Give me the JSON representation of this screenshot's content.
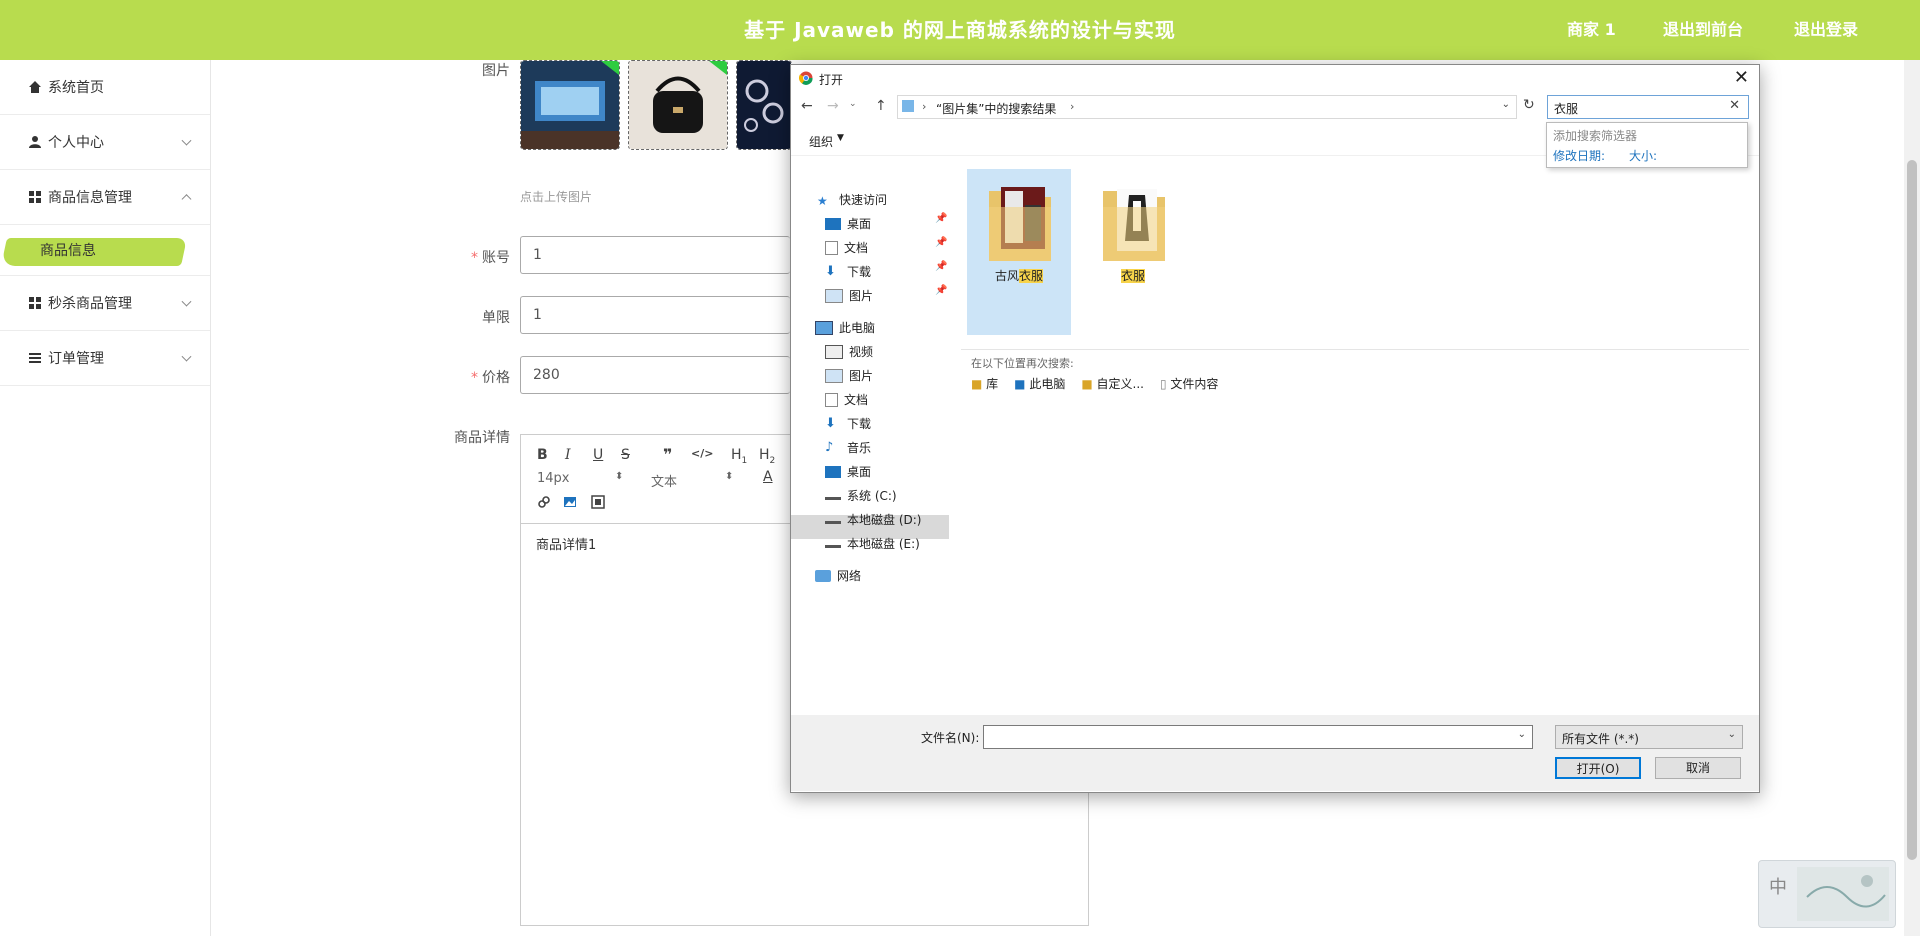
{
  "header": {
    "title": "基于 Javaweb 的网上商城系统的设计与实现",
    "links": [
      "商家 1",
      "退出到前台",
      "退出登录"
    ]
  },
  "sidebar": {
    "items": [
      {
        "label": "系统首页",
        "icon": "home-icon"
      },
      {
        "label": "个人中心",
        "icon": "user-icon"
      },
      {
        "label": "商品信息管理",
        "icon": "grid-icon",
        "expanded": true
      },
      {
        "label": "商品信息",
        "active": true
      },
      {
        "label": "秒杀商品管理",
        "icon": "grid-icon"
      },
      {
        "label": "订单管理",
        "icon": "list-icon"
      }
    ]
  },
  "form": {
    "image_label": "图片",
    "upload_hint": "点击上传图片",
    "account_label": "账号",
    "account_value": "1",
    "limit_label": "单限",
    "limit_value": "1",
    "price_label": "价格",
    "price_value": "280",
    "detail_label": "商品详情",
    "editor": {
      "font_size": "14px",
      "font_style": "文本",
      "content": "商品详情1"
    }
  },
  "dialog": {
    "title": "打开",
    "path": "“图片集”中的搜索结果",
    "search_value": "衣服",
    "organize": "组织",
    "suggest": {
      "title": "添加搜索筛选器",
      "filters": [
        "修改日期:",
        "大小:"
      ]
    },
    "tree": [
      {
        "label": "快速访问",
        "icon": "star-icon"
      },
      {
        "label": "桌面",
        "icon": "desktop-icon",
        "pinned": true
      },
      {
        "label": "文档",
        "icon": "document-icon",
        "pinned": true
      },
      {
        "label": "下载",
        "icon": "download-icon",
        "pinned": true
      },
      {
        "label": "图片",
        "icon": "picture-icon",
        "pinned": true
      },
      {
        "label": "此电脑",
        "icon": "computer-icon"
      },
      {
        "label": "视频",
        "icon": "video-icon"
      },
      {
        "label": "图片",
        "icon": "picture-icon"
      },
      {
        "label": "文档",
        "icon": "document-icon"
      },
      {
        "label": "下载",
        "icon": "download-icon"
      },
      {
        "label": "音乐",
        "icon": "music-icon"
      },
      {
        "label": "桌面",
        "icon": "desktop-icon",
        "selected": true
      },
      {
        "label": "系统 (C:)",
        "icon": "drive-icon"
      },
      {
        "label": "本地磁盘 (D:)",
        "icon": "drive-icon"
      },
      {
        "label": "本地磁盘 (E:)",
        "icon": "drive-icon"
      },
      {
        "label": "网络",
        "icon": "network-icon"
      }
    ],
    "folders": [
      {
        "prefix": "古风",
        "match": "衣服"
      },
      {
        "prefix": "",
        "match": "衣服"
      }
    ],
    "search_again": {
      "title": "在以下位置再次搜索:",
      "locations": [
        "库",
        "此电脑",
        "自定义...",
        "文件内容"
      ]
    },
    "filename_label": "文件名(N):",
    "filename_value": "",
    "filetype": "所有文件 (*.*)",
    "open_button": "打开(O)",
    "cancel_button": "取消"
  },
  "ime": {
    "label": "中"
  },
  "colors": {
    "accent": "#b8dc4e",
    "required": "#f56c6c",
    "highlight": "#f7d34a"
  }
}
